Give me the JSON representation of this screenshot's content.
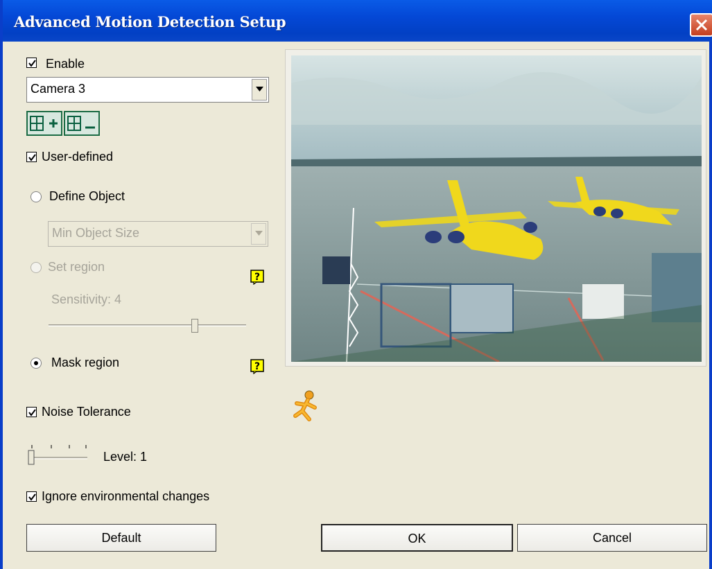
{
  "window": {
    "title": "Advanced Motion Detection Setup"
  },
  "enable": {
    "label": "Enable",
    "checked": true
  },
  "camera": {
    "selected": "Camera 3"
  },
  "grid_buttons": {
    "add_icon": "grid-add-icon",
    "remove_icon": "grid-remove-icon"
  },
  "user_defined": {
    "label": "User-defined",
    "checked": true
  },
  "define_object": {
    "label": "Define Object",
    "selected": false
  },
  "object_size": {
    "selected": "Min Object Size",
    "enabled": false
  },
  "set_region": {
    "label": "Set region",
    "selected": false,
    "enabled": false
  },
  "sensitivity": {
    "label": "Sensitivity: 4",
    "value": 4
  },
  "mask_region": {
    "label": "Mask region",
    "selected": true
  },
  "noise_tolerance": {
    "label": "Noise Tolerance",
    "checked": true
  },
  "level": {
    "label": "Level: 1",
    "value": 1
  },
  "ignore_env": {
    "label": "Ignore environmental changes",
    "checked": true
  },
  "buttons": {
    "default": "Default",
    "ok": "OK",
    "cancel": "Cancel"
  },
  "icons": {
    "help": "help-icon",
    "motion": "running-man-icon",
    "close": "close-icon"
  },
  "colors": {
    "titlebar": "#0448d6",
    "close": "#c43e1e",
    "face": "#ece9d8",
    "help": "#ffff00"
  }
}
